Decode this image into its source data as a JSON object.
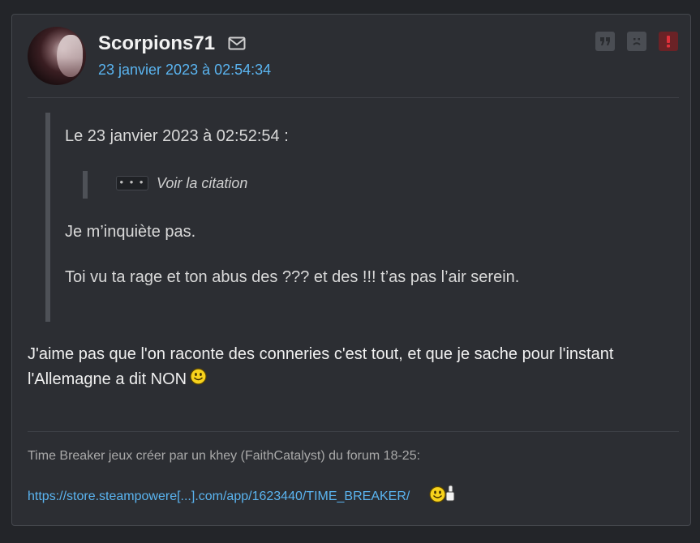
{
  "post": {
    "username": "Scorpions71",
    "date": "23 janvier 2023 à 02:54:34",
    "icons": {
      "message": "envelope-icon",
      "quote": "quote-icon",
      "sad": "sad-face-icon",
      "report": "alert-icon"
    },
    "colors": {
      "link": "#5ab4f0",
      "alert_bg": "#6a2226",
      "alert_fg": "#e0303a"
    }
  },
  "quote": {
    "header": "Le 23 janvier 2023 à 02:52:54 :",
    "nested_button": "• • •",
    "nested_label": "Voir la citation",
    "line1": "Je m’inquiète pas.",
    "line2": "Toi vu ta rage et ton abus des ??? et des !!! t’as pas l’air serein."
  },
  "message": {
    "text": "J'aime pas que l'on raconte des conneries c'est tout, et que je sache pour l'instant l'Allemagne a dit NON",
    "emoji": "smiley-icon"
  },
  "signature": {
    "text": "Time Breaker jeux créer par un khey (FaithCatalyst) du forum 18-25:",
    "link": "https://store.steampowere[...].com/app/1623440/TIME_BREAKER/",
    "emoji": "smiley-thumbs-up-icon"
  }
}
